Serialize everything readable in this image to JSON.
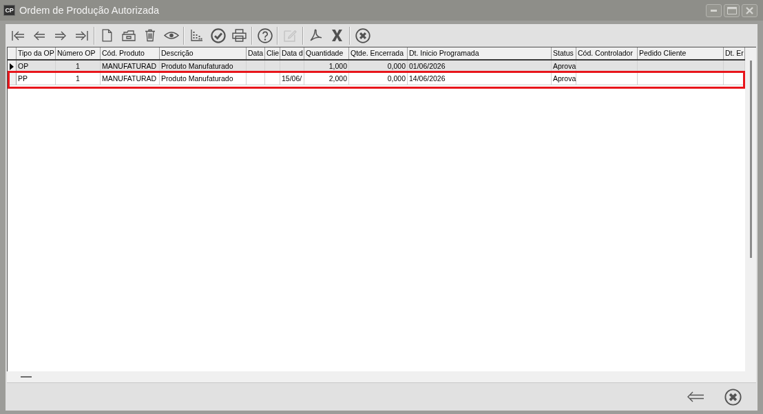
{
  "window": {
    "icon_label": "CP",
    "title": "Ordem de Produção Autorizada"
  },
  "toolbar": {
    "groups": [
      [
        {
          "kind": "first",
          "disabled": false
        },
        {
          "kind": "previous",
          "disabled": false
        },
        {
          "kind": "next",
          "disabled": false
        },
        {
          "kind": "last",
          "disabled": false
        }
      ],
      [
        {
          "kind": "new",
          "disabled": false
        },
        {
          "kind": "open",
          "disabled": false
        },
        {
          "kind": "delete",
          "disabled": false
        },
        {
          "kind": "view",
          "disabled": false
        }
      ],
      [
        {
          "kind": "chart",
          "disabled": false
        },
        {
          "kind": "confirm",
          "disabled": false
        },
        {
          "kind": "print",
          "disabled": false
        }
      ],
      [
        {
          "kind": "help",
          "disabled": false
        }
      ],
      [
        {
          "kind": "edit",
          "disabled": true
        }
      ],
      [
        {
          "kind": "pdf",
          "disabled": false
        },
        {
          "kind": "excel",
          "disabled": false
        }
      ],
      [
        {
          "kind": "cancel",
          "disabled": false
        }
      ]
    ]
  },
  "table": {
    "columns": [
      "Tipo da OP",
      "Número OP",
      "Cód. Produto",
      "Descrição",
      "Data",
      "Clie",
      "Data d",
      "Quantidade",
      "Qtde. Encerrada",
      "Dt. Inicio Programada",
      "Status",
      "Cód. Controlador",
      "Pedido Cliente",
      "Dt. Er"
    ],
    "rows": [
      {
        "selected": true,
        "highlighted": false,
        "cells": [
          "OP",
          "1",
          "MANUFATURAD",
          "Produto Manufaturado",
          null,
          null,
          null,
          "1,000",
          "0,000",
          "01/06/2026",
          "Aprova",
          null,
          null,
          null
        ]
      },
      {
        "selected": false,
        "highlighted": true,
        "cells": [
          "PP",
          "1",
          "MANUFATURAD",
          "Produto Manufaturado",
          null,
          null,
          "15/06/",
          "2,000",
          "0,000",
          "14/06/2026",
          "Aprova",
          null,
          null,
          null
        ]
      }
    ]
  }
}
